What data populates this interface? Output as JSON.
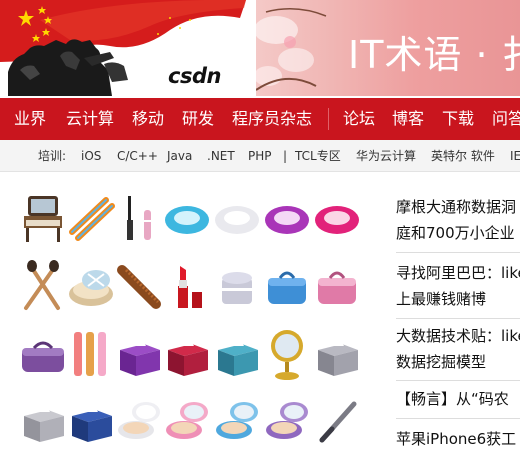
{
  "header": {
    "logo_text": "CSDN",
    "logo_wordmark": "csdn",
    "banner_text": "IT术语 · 扌"
  },
  "nav": {
    "items": [
      {
        "label": "业界"
      },
      {
        "label": "云计算"
      },
      {
        "label": "移动"
      },
      {
        "label": "研发"
      },
      {
        "label": "程序员杂志"
      },
      {
        "label": "论坛"
      },
      {
        "label": "博客"
      },
      {
        "label": "下载"
      },
      {
        "label": "问答"
      }
    ],
    "background_color": "#c9151e"
  },
  "subnav": {
    "prefix": "培训:",
    "items": [
      {
        "label": "iOS"
      },
      {
        "label": "C/C++"
      },
      {
        "label": "Java"
      },
      {
        "label": ".NET"
      },
      {
        "label": "PHP"
      },
      {
        "label": "|"
      },
      {
        "label": "TCL专区"
      },
      {
        "label": "华为云计算"
      },
      {
        "label": "英特尔 软件"
      },
      {
        "label": "IE"
      }
    ]
  },
  "icons": [
    {
      "name": "vanity-mirror-icon"
    },
    {
      "name": "hair-clips-icon"
    },
    {
      "name": "mascara-icon"
    },
    {
      "name": "powder-puff-blue-icon"
    },
    {
      "name": "powder-puff-white-icon"
    },
    {
      "name": "powder-puff-purple-icon"
    },
    {
      "name": "powder-puff-pink-icon"
    },
    {
      "name": "makeup-brushes-icon"
    },
    {
      "name": "compact-powder-icon"
    },
    {
      "name": "comb-icon"
    },
    {
      "name": "lipstick-icon"
    },
    {
      "name": "cream-jar-icon"
    },
    {
      "name": "cosmetic-case-blue-icon"
    },
    {
      "name": "cosmetic-case-pink-icon"
    },
    {
      "name": "cosmetic-case-purple-icon"
    },
    {
      "name": "lip-gloss-set-icon"
    },
    {
      "name": "tissue-box-purple-icon"
    },
    {
      "name": "tissue-box-red-icon"
    },
    {
      "name": "tissue-box-teal-icon"
    },
    {
      "name": "round-mirror-icon"
    },
    {
      "name": "tissue-box-gray-icon"
    },
    {
      "name": "tissue-box-silver-icon"
    },
    {
      "name": "tissue-box-navy-icon"
    },
    {
      "name": "compact-open-white-icon"
    },
    {
      "name": "compact-open-pink-icon"
    },
    {
      "name": "compact-open-blue-icon"
    },
    {
      "name": "compact-open-purple-icon"
    },
    {
      "name": "nail-file-icon"
    }
  ],
  "news": {
    "items": [
      {
        "text": "摩根大通称数据洞"
      },
      {
        "text": "庭和700万小企业"
      },
      {
        "text": "寻找阿里巴巴：likely"
      },
      {
        "text": "上最赚钱赌博"
      },
      {
        "text": "大数据技术贴：likely"
      },
      {
        "text": "数据挖掘模型"
      },
      {
        "text": "【畅言】从“码农"
      },
      {
        "text": "苹果iPhone6获工"
      }
    ]
  }
}
